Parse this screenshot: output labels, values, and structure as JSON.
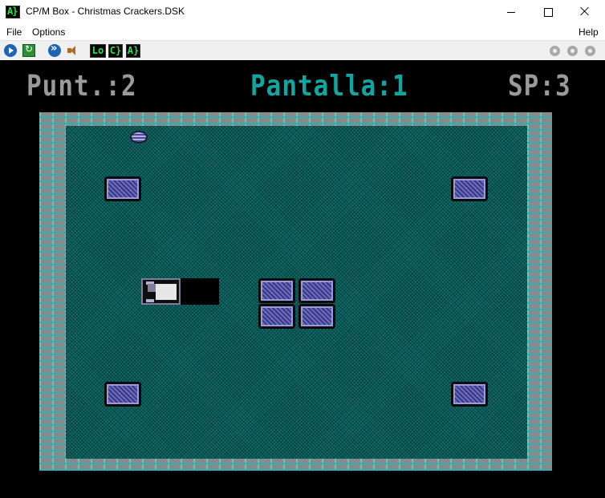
{
  "window": {
    "title": "CP/M Box - Christmas Crackers.DSK",
    "icon_text": "A}"
  },
  "menu": {
    "file": "File",
    "options": "Options",
    "help": "Help"
  },
  "toolbar": {
    "icons": [
      "play-icon",
      "reset-icon",
      "fast-forward-icon",
      "speaker-icon"
    ],
    "chips": {
      "lo": "Lo",
      "c": "C}",
      "a": "A}"
    },
    "right_icons": [
      "gear-icon",
      "gear-icon",
      "gear-icon"
    ]
  },
  "game": {
    "score": "Punt.:2",
    "level": "Pantalla:1",
    "sp": "SP:3",
    "colors": {
      "background": "#000000",
      "hud_gray": "#9a9a9a",
      "hud_cyan": "#12a6a0",
      "field": "#0f6f6c",
      "brick": "#1fa5a5",
      "cracker": "#4c4c9a"
    }
  }
}
